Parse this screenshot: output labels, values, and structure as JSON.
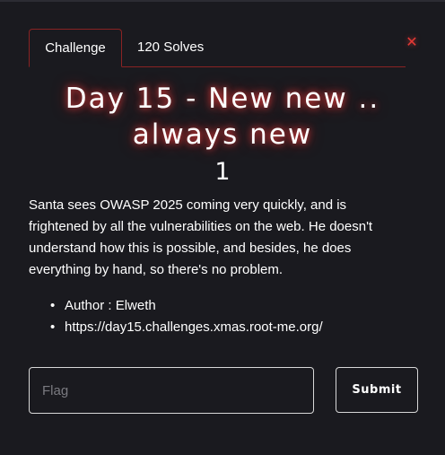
{
  "modal": {
    "tabs": [
      {
        "label": "Challenge",
        "active": true
      },
      {
        "label": "120 Solves",
        "active": false
      }
    ],
    "close_icon": "close-icon",
    "title": "Day 15 - New new .. always new",
    "points": "1",
    "description": "Santa sees OWASP 2025 coming very quickly, and is frightened by all the vulnerabilities on the web. He doesn't understand how this is possible, and besides, he does everything by hand, so there's no problem.",
    "meta": [
      "Author : Elweth",
      "https://day15.challenges.xmas.root-me.org/"
    ],
    "flag_placeholder": "Flag",
    "flag_value": "",
    "submit_label": "Submit"
  },
  "colors": {
    "background": "#1a1a1f",
    "accent": "#8a2323",
    "close": "#e53935",
    "glow": "#ff4646"
  }
}
